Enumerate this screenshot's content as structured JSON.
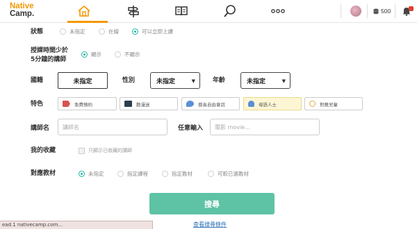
{
  "header": {
    "logo_line1": "Native",
    "logo_line2": "Camp.",
    "nav": [
      "home-icon",
      "signpost-icon",
      "book-icon",
      "search-icon",
      "more-icon"
    ],
    "coins": "500",
    "notification_count": "1"
  },
  "form": {
    "status": {
      "label": "狀態",
      "options": [
        "未指定",
        "在線",
        "可以立即上課"
      ],
      "selected": 2
    },
    "min_lessons": {
      "label_line1": "授課時間少於",
      "label_line2": "5分鐘的講師",
      "options": [
        "顯示",
        "不顯示"
      ],
      "selected": 0
    },
    "nationality": {
      "label": "國籍",
      "value": "未指定"
    },
    "gender": {
      "label": "性別",
      "value": "未指定"
    },
    "age": {
      "label": "年齡",
      "value": "未指定"
    },
    "features": {
      "label": "特色",
      "tags": [
        "免費預約",
        "動漫迷",
        "擅長自由會話",
        "母語人士",
        "對應兒童"
      ],
      "tag_colors": [
        "#d9534f",
        "#2c3e50",
        "#5b8fd6",
        "#5b8fd6",
        "#e5a93c"
      ]
    },
    "tutor_name": {
      "label": "講師名",
      "placeholder": "講師名"
    },
    "keyword": {
      "label": "任意輸入",
      "placeholder": "電影 movie..."
    },
    "favorites": {
      "label": "我的收藏",
      "checkbox_label": "只顯示已收藏的講師"
    },
    "material": {
      "label": "對應教材",
      "options": [
        "未指定",
        "指定課程",
        "指定教材",
        "可較已選教材"
      ],
      "selected": 0
    },
    "search_button": "搜尋",
    "more_conditions": "查看搜尋條件"
  },
  "statusbar": {
    "text": "ead.1 nativecamp.com..."
  }
}
